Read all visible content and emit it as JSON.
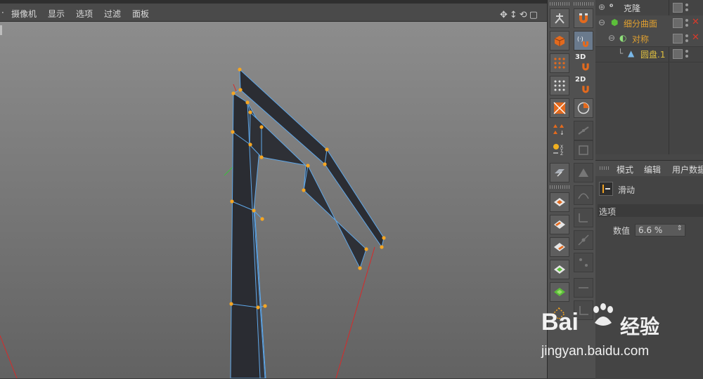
{
  "viewport": {
    "menu": [
      "摄像机",
      "显示",
      "选项",
      "过滤",
      "面板"
    ]
  },
  "object_manager": {
    "items": [
      {
        "label": "克隆",
        "color": "#d8d8d8"
      },
      {
        "label": "细分曲面",
        "color": "#e0a030"
      },
      {
        "label": "对称",
        "color": "#e0a030"
      },
      {
        "label": "圆盘.1",
        "color": "#e0c040"
      }
    ]
  },
  "attributes": {
    "tabs": [
      "模式",
      "编辑",
      "用户数据"
    ],
    "tool_name": "滑动",
    "section": "选项",
    "param_label": "数值",
    "param_value": "6.6 %"
  },
  "palette": {
    "badges": [
      "3D",
      "2D"
    ]
  },
  "watermark": {
    "brand": "Bai",
    "brand2": "经验",
    "url": "jingyan.baidu.com"
  },
  "colors": {
    "accent_orange": "#f5a623",
    "mesh_edge": "#5fa7e8",
    "mesh_face": "#2e3036",
    "axis_red": "#d82a2a",
    "active_tag": "#e0a030"
  }
}
